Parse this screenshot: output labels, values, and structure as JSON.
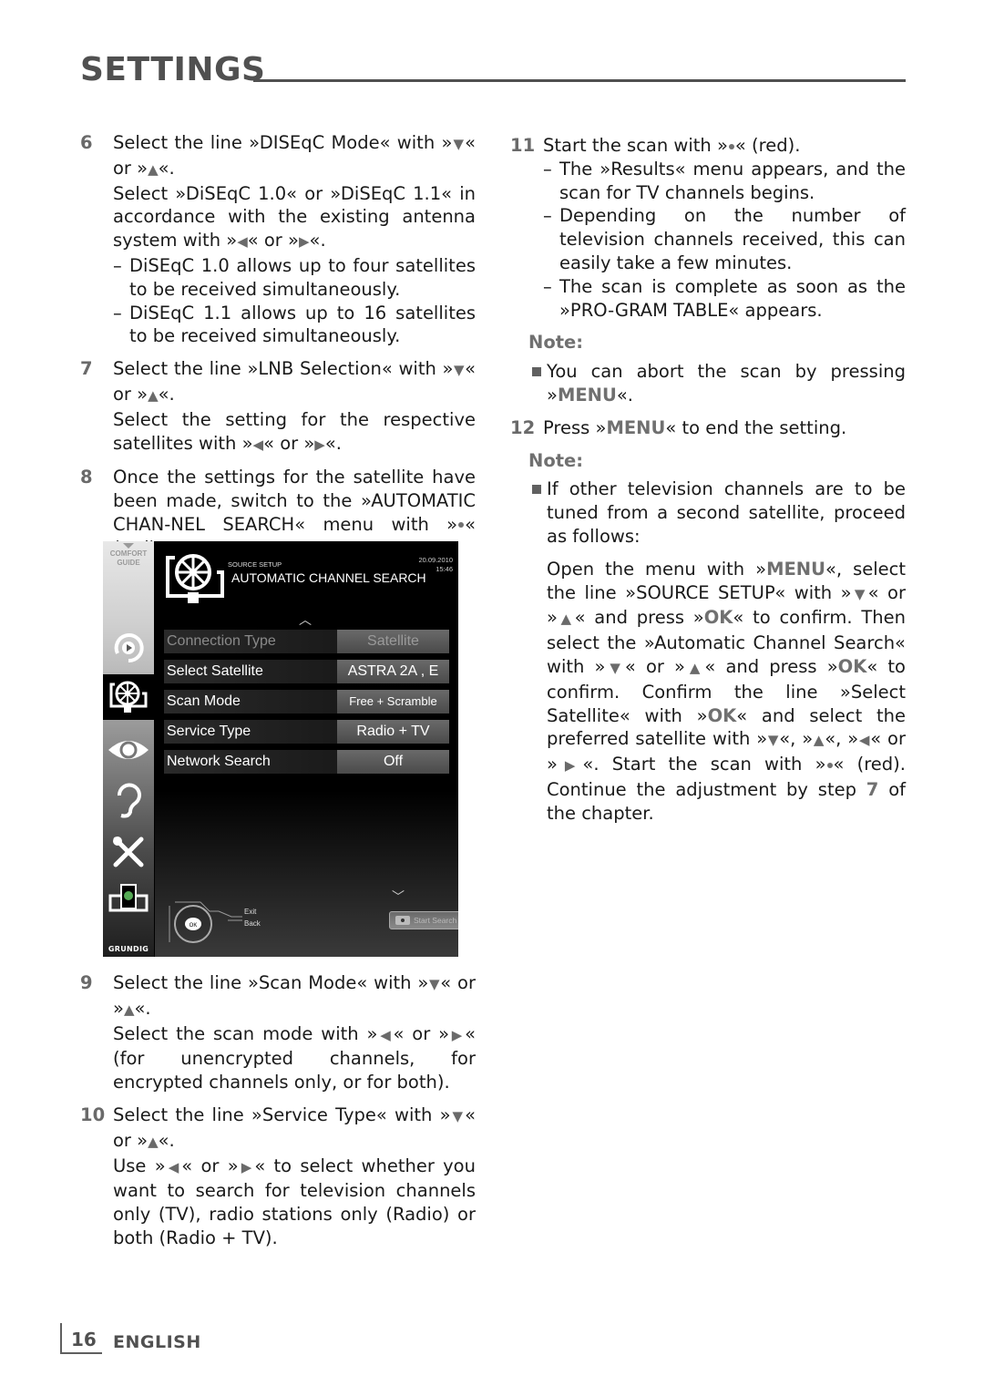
{
  "header": {
    "title": "SETTINGS"
  },
  "left_column": {
    "step6": {
      "num": "6",
      "line1_a": "Select the line »DISEqC Mode« with »",
      "line1_b": "« or »",
      "line1_c": "«.",
      "line2_a": "Select »DiSEqC 1.0« or »DiSEqC 1.1« in accordance with the existing antenna system with »",
      "line2_b": "« or »",
      "line2_c": "«.",
      "dash1": "DiSEqC 1.0 allows up to four satellites to be received simultaneously.",
      "dash2": "DiSEqC 1.1 allows up to 16 satellites to be received simultaneously."
    },
    "step7": {
      "num": "7",
      "line1_a": "Select the line »LNB Selection« with »",
      "line1_b": "« or »",
      "line1_c": "«.",
      "line2_a": "Select the setting for the respective satellites with »",
      "line2_b": "« or »",
      "line2_c": "«."
    },
    "step8": {
      "num": "8",
      "text_a": "Once the settings for the satellite have been made, switch to the »AUTOMATIC CHAN-NEL SEARCH« menu with »",
      "text_b": "« (red)."
    },
    "step9": {
      "num": "9",
      "line1_a": "Select the line »Scan Mode« with »",
      "line1_b": "« or »",
      "line1_c": "«.",
      "line2_a": "Select the scan mode with »",
      "line2_b": "« or »",
      "line2_c": "« (for unencrypted channels, for encrypted channels only, or for both)."
    },
    "step10": {
      "num": "10",
      "line1_a": "Select the line »Service Type« with »",
      "line1_b": "« or »",
      "line1_c": "«.",
      "line2_a": "Use »",
      "line2_b": "« or »",
      "line2_c": "« to select whether you want to search for television channels only (TV), radio stations only (Radio) or both (Radio + TV)."
    }
  },
  "arrows": {
    "down": "▼",
    "up": "▲",
    "left": "◀",
    "right": "▶"
  },
  "tv_screen": {
    "comfort_guide": [
      "COMFORT",
      "GUIDE"
    ],
    "brand": "GRUNDIG",
    "sidebar_icons": [
      "source-icon",
      "satellite-dish-icon",
      "eye-icon",
      "ear-icon",
      "tools-icon",
      "network-icon"
    ],
    "subtitle": "SOURCE SETUP",
    "title": "AUTOMATIC CHANNEL SEARCH",
    "date": "20.09.2010",
    "time": "15:46",
    "rows": [
      {
        "label": "Connection Type",
        "value": "Satellite",
        "disabled": true
      },
      {
        "label": "Select Satellite",
        "value": "ASTRA 2A , E",
        "disabled": false
      },
      {
        "label": "Scan Mode",
        "value": "Free + Scramble",
        "disabled": false
      },
      {
        "label": "Service Type",
        "value": "Radio + TV",
        "disabled": false
      },
      {
        "label": "Network Search",
        "value": "Off",
        "disabled": false
      }
    ],
    "nav_ok": "OK",
    "exit_label": "Exit",
    "back_label": "Back",
    "start_search_label": "Start Search"
  },
  "right_column": {
    "step11": {
      "num": "11",
      "text_a": "Start the scan with »",
      "text_b": "« (red).",
      "dash1": "The »Results« menu appears, and the scan for TV channels begins.",
      "dash2": "Depending on the number of television channels received, this can easily take a few minutes.",
      "dash3": "The scan is complete as soon as the »PRO-GRAM TABLE« appears."
    },
    "note1": {
      "title": "Note:",
      "bullet_a": "You can abort the scan by pressing »",
      "bullet_key": "MENU",
      "bullet_b": "«."
    },
    "step12": {
      "num": "12",
      "text_a": "Press »",
      "key": "MENU",
      "text_b": "« to end the setting."
    },
    "note2": {
      "title": "Note:",
      "bullet": "If other television channels are to be tuned from a second satellite, proceed as follows:",
      "p1": "Open the menu with »",
      "k_menu": "MENU",
      "p2": "«, select the line »SOURCE SETUP« with »",
      "p3": "« or »",
      "p4": "« and press »",
      "k_ok": "OK",
      "p5": "« to confirm. Then select the »Automatic Channel Search« with »",
      "p6": "« or »",
      "p7": "« and press »",
      "p8": "« to confirm. Confirm the line »Select Satellite« with »",
      "p9": "« and select the preferred satellite with »",
      "p10": "«, »",
      "p11": "«, »",
      "p12": "« or »",
      "p13": "«. Start the scan with »",
      "p14": "« (red). Continue the adjustment by step ",
      "k_step": "7",
      "p15": " of the chapter."
    }
  },
  "footer": {
    "page_number": "16",
    "language": "ENGLISH"
  }
}
